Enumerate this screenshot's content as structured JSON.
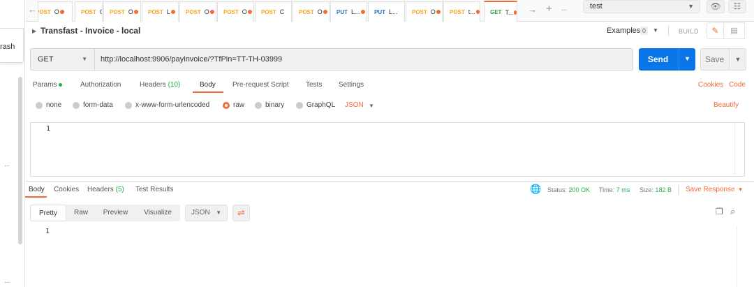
{
  "sidebar": {
    "trash_label": "rash",
    "more_label": "···"
  },
  "tabs": [
    {
      "method": "POST",
      "name": "O",
      "dot": true,
      "cut": true
    },
    {
      "method": "POST",
      "name": "O",
      "dot": true
    },
    {
      "method": "POST",
      "name": "O",
      "dot": true
    },
    {
      "method": "POST",
      "name": "L",
      "dot": true
    },
    {
      "method": "POST",
      "name": "O",
      "dot": true
    },
    {
      "method": "POST",
      "name": "O",
      "dot": true
    },
    {
      "method": "POST",
      "name": "C",
      "dot": false
    },
    {
      "method": "POST",
      "name": "O",
      "dot": true
    },
    {
      "method": "PUT",
      "name": "L...",
      "dot": true
    },
    {
      "method": "PUT",
      "name": "L...",
      "dot": false
    },
    {
      "method": "POST",
      "name": "O",
      "dot": true
    },
    {
      "method": "POST",
      "name": "t...",
      "dot": true
    },
    {
      "method": "GET",
      "name": "T...",
      "dot": true,
      "active": true
    }
  ],
  "tab_controls": {
    "forward": "→",
    "back": "←",
    "add": "+",
    "more": "···"
  },
  "environment": {
    "selected": "test"
  },
  "request": {
    "title": "Transfast - Invoice - local",
    "examples_label": "Examples",
    "examples_count": "0",
    "build_label": "BUILD",
    "method": "GET",
    "url": "http://localhost:9906/payinvoice/?TfPin=TT-TH-03999",
    "send_label": "Send",
    "save_label": "Save"
  },
  "request_tabs": {
    "params": "Params",
    "authorization": "Authorization",
    "headers": "Headers",
    "headers_count": "(10)",
    "body": "Body",
    "pre_request": "Pre-request Script",
    "tests": "Tests",
    "settings": "Settings",
    "cookies": "Cookies",
    "code": "Code"
  },
  "body_types": {
    "none": "none",
    "form_data": "form-data",
    "urlencoded": "x-www-form-urlencoded",
    "raw": "raw",
    "binary": "binary",
    "graphql": "GraphQL",
    "format": "JSON",
    "beautify": "Beautify",
    "selected": "raw"
  },
  "editor": {
    "line_number": "1"
  },
  "response": {
    "tabs": {
      "body": "Body",
      "cookies": "Cookies",
      "headers": "Headers",
      "headers_count": "(5)",
      "test_results": "Test Results"
    },
    "status_label": "Status:",
    "status_value": "200 OK",
    "time_label": "Time:",
    "time_value": "7 ms",
    "size_label": "Size:",
    "size_value": "182 B",
    "save_response": "Save Response",
    "views": {
      "pretty": "Pretty",
      "raw": "Raw",
      "preview": "Preview",
      "visualize": "Visualize"
    },
    "format": "JSON",
    "line_number": "1"
  },
  "colors": {
    "accent": "#f26b3a",
    "send": "#0b76e8",
    "success": "#26b14c",
    "post": "#f5a623",
    "put": "#2a6fb9",
    "get": "#2b9c45"
  }
}
